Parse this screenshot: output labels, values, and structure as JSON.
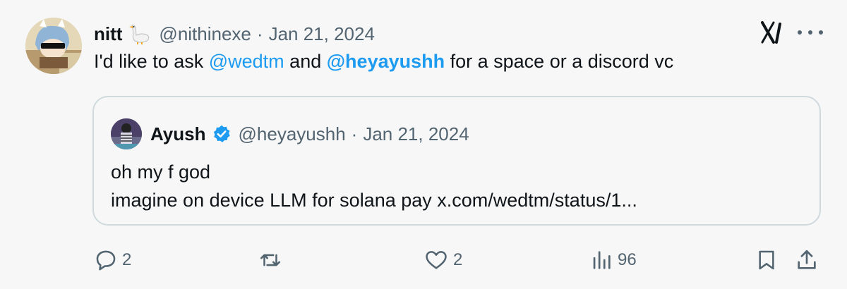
{
  "tweet": {
    "author_name": "nitt",
    "author_handle": "@nithinexe",
    "separator": "·",
    "date": "Jan 21, 2024",
    "text_before": "I'd like to ask ",
    "mention_1": "@wedtm",
    "text_middle": " and ",
    "mention_2": "@heyayushh",
    "text_after": " for a space or a discord vc"
  },
  "quote": {
    "author_name": "Ayush",
    "author_handle": "@heyayushh",
    "separator": "·",
    "date": "Jan 21, 2024",
    "line_1": "oh my f god",
    "line_2": "imagine on device LLM for solana pay x.com/wedtm/status/1..."
  },
  "actions": {
    "reply_count": "2",
    "like_count": "2",
    "views_count": "96"
  },
  "icons": [
    "goose-emoji-icon",
    "x-logo-icon",
    "more-icon",
    "verified-badge-icon",
    "reply-icon",
    "retweet-icon",
    "like-icon",
    "views-icon",
    "bookmark-icon",
    "share-icon"
  ],
  "colors": {
    "link": "#1d9bf0",
    "secondary_text": "#536471",
    "verified": "#1d9bf0",
    "border": "#cfd9de"
  }
}
